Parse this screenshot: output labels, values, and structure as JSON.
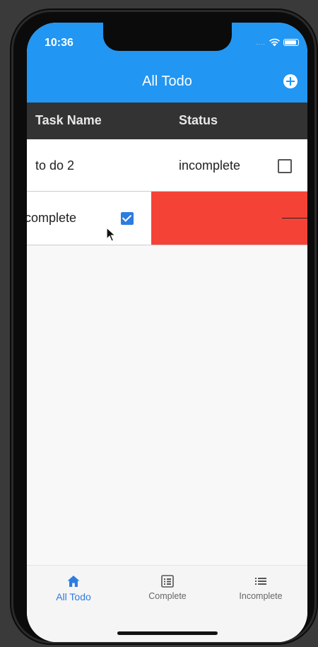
{
  "status_bar": {
    "time": "10:36",
    "signal_dots": "...."
  },
  "appbar": {
    "title": "All Todo",
    "add_icon": "plus-circle-icon"
  },
  "table": {
    "headers": [
      "Task Name",
      "Status"
    ],
    "rows": [
      {
        "name": "to do 2",
        "status": "incomplete",
        "checked": false
      },
      {
        "name": "complete",
        "checked": true,
        "swiping": true
      }
    ]
  },
  "colors": {
    "primary": "#2196f3",
    "header_bg": "#333333",
    "delete_bg": "#f44336",
    "check": "#2d7ce0"
  },
  "bottom_nav": {
    "items": [
      {
        "label": "All Todo",
        "icon": "home-icon",
        "active": true
      },
      {
        "label": "Complete",
        "icon": "list-box-icon",
        "active": false
      },
      {
        "label": "Incomplete",
        "icon": "list-icon",
        "active": false
      }
    ]
  }
}
